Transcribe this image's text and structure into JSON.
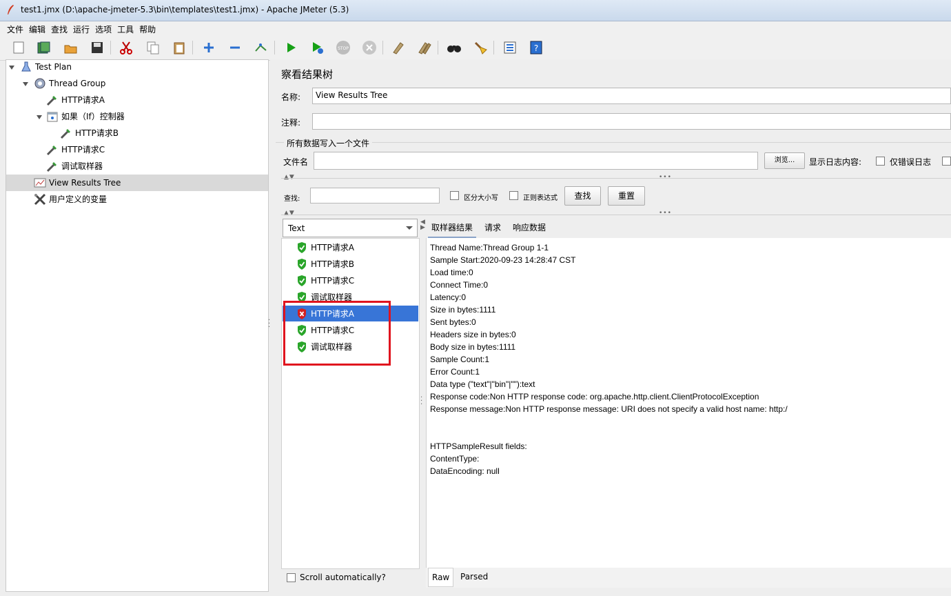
{
  "window": {
    "title": "test1.jmx (D:\\apache-jmeter-5.3\\bin\\templates\\test1.jmx) - Apache JMeter (5.3)"
  },
  "menu": [
    "文件",
    "编辑",
    "查找",
    "运行",
    "选项",
    "工具",
    "帮助"
  ],
  "toolbar": [
    "new-icon",
    "templates-icon",
    "open-icon",
    "save-icon",
    "cut-icon",
    "copy-icon",
    "paste-icon",
    "expand-icon",
    "collapse-icon",
    "toggle-icon",
    "start-icon",
    "start-no-pause-icon",
    "stop-icon",
    "shutdown-icon",
    "clear-icon",
    "clear-all-icon",
    "search-icon",
    "reset-search-icon",
    "function-helper-icon",
    "help-icon"
  ],
  "tree": {
    "items": [
      {
        "label": "Test Plan",
        "icon": "test-plan-icon"
      },
      {
        "label": "Thread Group",
        "icon": "thread-group-icon"
      },
      {
        "label": "HTTP请求A",
        "icon": "sampler-icon"
      },
      {
        "label": "如果（If）控制器",
        "icon": "controller-icon"
      },
      {
        "label": "HTTP请求B",
        "icon": "sampler-icon"
      },
      {
        "label": "HTTP请求C",
        "icon": "sampler-icon"
      },
      {
        "label": "调试取样器",
        "icon": "sampler-icon"
      },
      {
        "label": "View Results Tree",
        "icon": "listener-icon"
      },
      {
        "label": "用户定义的变量",
        "icon": "config-icon"
      }
    ],
    "selected": "View Results Tree"
  },
  "panel": {
    "title": "察看结果树",
    "name_label": "名称:",
    "name_value": "View Results Tree",
    "comment_label": "注释:",
    "comment_value": "",
    "file_group_title": "所有数据写入一个文件",
    "filename_label": "文件名",
    "filename_value": "",
    "browse_button": "浏览...",
    "log_label": "显示日志内容:",
    "errors_only_label": "仅错误日志",
    "search_label": "查找:",
    "search_value": "",
    "case_sensitive_label": "区分大小写",
    "regex_label": "正则表达式",
    "search_button": "查找",
    "reset_button": "重置",
    "renderer": "Text",
    "scroll_auto": "Scroll automatically?"
  },
  "results": [
    {
      "label": "HTTP请求A",
      "status": "success"
    },
    {
      "label": "HTTP请求B",
      "status": "success"
    },
    {
      "label": "HTTP请求C",
      "status": "success"
    },
    {
      "label": "调试取样器",
      "status": "success"
    },
    {
      "label": "HTTP请求A",
      "status": "error"
    },
    {
      "label": "HTTP请求C",
      "status": "success"
    },
    {
      "label": "调试取样器",
      "status": "success"
    }
  ],
  "detail_tabs": [
    "取样器结果",
    "请求",
    "响应数据"
  ],
  "detail_lines": [
    "Thread Name:Thread Group 1-1",
    "Sample Start:2020-09-23 14:28:47 CST",
    "Load time:0",
    "Connect Time:0",
    "Latency:0",
    "Size in bytes:1111",
    "Sent bytes:0",
    "Headers size in bytes:0",
    "Body size in bytes:1111",
    "Sample Count:1",
    "Error Count:1",
    "Data type (\"text\"|\"bin\"|\"\"):text",
    "Response code:Non HTTP response code: org.apache.http.client.ClientProtocolException",
    "Response message:Non HTTP response message: URI does not specify a valid host name: http:/",
    "",
    "",
    "HTTPSampleResult fields:",
    "ContentType:",
    "DataEncoding: null"
  ],
  "bottom_tabs": [
    "Raw",
    "Parsed"
  ],
  "colors": {
    "selection": "#3875d7",
    "highlight_box": "#e0141e",
    "success": "#2aa52a",
    "error": "#d42020"
  }
}
